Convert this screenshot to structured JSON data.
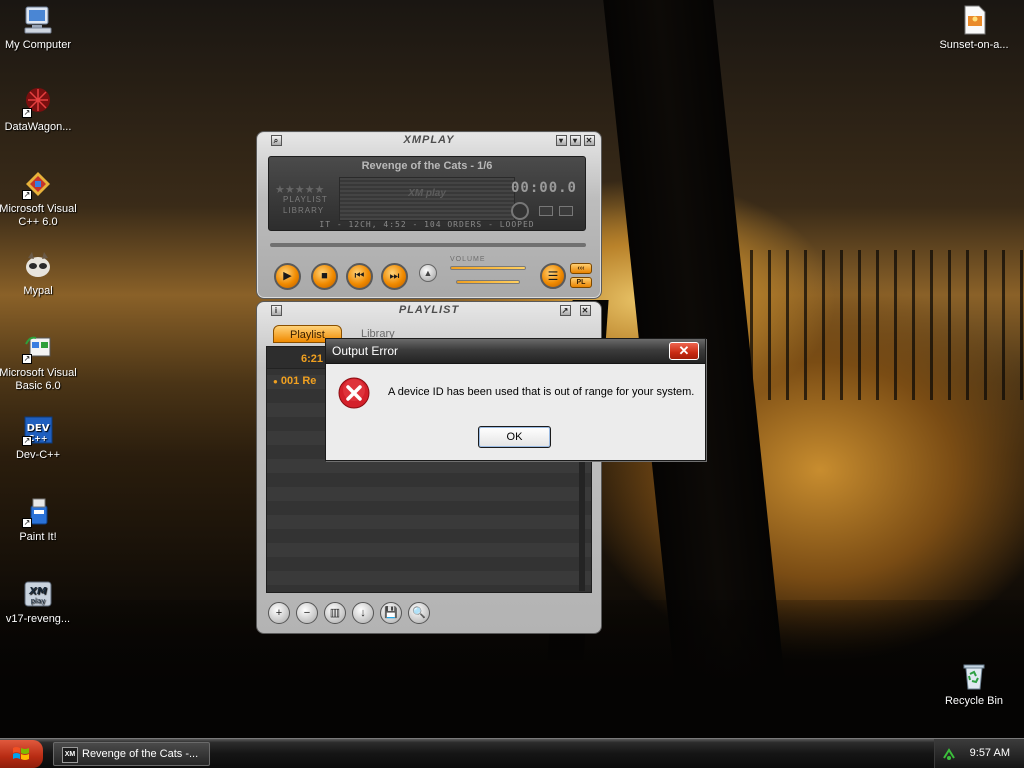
{
  "desktop": {
    "icons": [
      {
        "label": "My Computer",
        "icon": "computer-icon"
      },
      {
        "label": "DataWagon...",
        "icon": "datawagon-icon"
      },
      {
        "label": "Microsoft Visual C++ 6.0",
        "icon": "visual-cpp-icon"
      },
      {
        "label": "Mypal",
        "icon": "mypal-icon"
      },
      {
        "label": "Microsoft Visual Basic 6.0",
        "icon": "visual-basic-icon"
      },
      {
        "label": "Dev-C++",
        "icon": "devcpp-icon"
      },
      {
        "label": "Paint It!",
        "icon": "paint-icon"
      },
      {
        "label": "v17-reveng...",
        "icon": "xmplay-file-icon"
      }
    ],
    "right_icons": [
      {
        "label": "Sunset-on-a...",
        "icon": "image-file-icon"
      },
      {
        "label": "Recycle Bin",
        "icon": "recycle-bin-icon"
      }
    ]
  },
  "xmplay": {
    "title": "XMPLAY",
    "track": "Revenge of the Cats - 1/6",
    "stars": "★★★★★",
    "time": "00:00.0",
    "vis_logo": "XM play",
    "side_playlist": "PLAYLIST",
    "side_library": "LIBRARY",
    "info": "IT - 12CH, 4:52 - 104 ORDERS - LOOPED",
    "volume_label": "VOLUME",
    "buttons": {
      "play": "▶",
      "stop": "■",
      "prev": "⏮",
      "next": "⏭",
      "eject": "▲",
      "menu": "☰",
      "small_top": "‹‹‹",
      "small_pl": "PL"
    }
  },
  "playlist": {
    "title": "PLAYLIST",
    "tabs": [
      "Playlist",
      "Library"
    ],
    "total_time": "6:21",
    "rows": [
      "001 Re"
    ],
    "tools": [
      "+",
      "−",
      "▥",
      "↓",
      "💾",
      "🔍"
    ]
  },
  "dialog": {
    "title": "Output Error",
    "close": "✕",
    "message": "A device ID has been used that is out of range for your system.",
    "ok": "OK",
    "icon": "error-icon"
  },
  "taskbar": {
    "task_label": "Revenge of the Cats -...",
    "task_icon_text": "XM",
    "clock": "9:57 AM"
  },
  "colors": {
    "accent_orange": "#f08a00",
    "error_red": "#d4202a",
    "taskbar_dark": "#151515"
  }
}
